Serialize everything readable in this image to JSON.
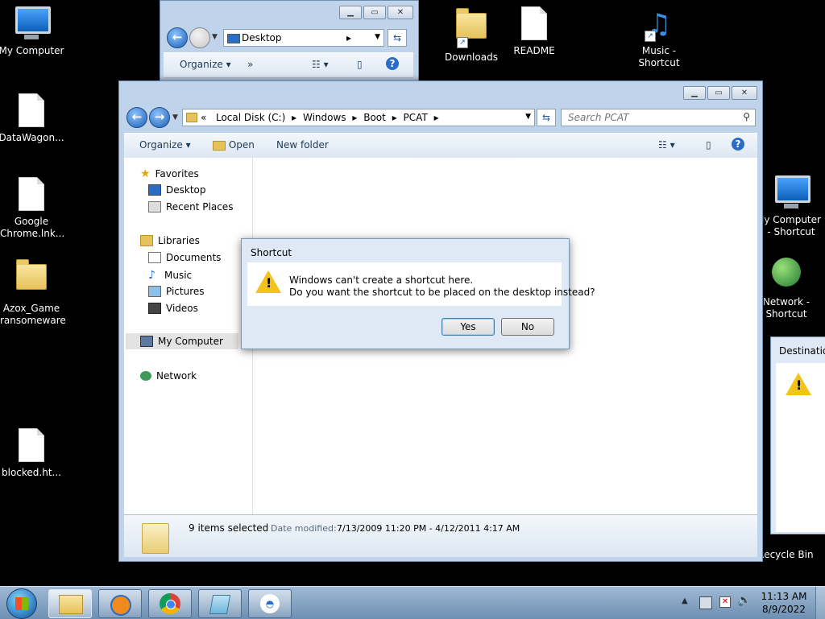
{
  "desktop": {
    "icons_left": [
      {
        "label": "My Computer",
        "kind": "computer"
      },
      {
        "label": "DataWagon...",
        "kind": "file"
      },
      {
        "label": "Google Chrome.lnk...",
        "kind": "file"
      },
      {
        "label": "Azox_Game ransomeware",
        "kind": "folder"
      },
      {
        "label": "blocked.ht...",
        "kind": "file"
      }
    ],
    "icons_top": [
      {
        "label": "Downloads",
        "kind": "folder-shortcut"
      },
      {
        "label": "README",
        "kind": "file"
      },
      {
        "label": "Music - Shortcut",
        "kind": "music-shortcut"
      }
    ],
    "icons_right": [
      {
        "label": "ly Computer - Shortcut"
      },
      {
        "label": "Network - Shortcut"
      },
      {
        "label": "Recycle Bin"
      }
    ]
  },
  "back_window": {
    "address": "Desktop",
    "toolbar": {
      "organize": "Organize",
      "more": "»"
    }
  },
  "explorer": {
    "breadcrumb": [
      "«",
      "Local Disk (C:)",
      "Windows",
      "Boot",
      "PCAT"
    ],
    "search_placeholder": "Search PCAT",
    "toolbar": {
      "organize": "Organize",
      "open": "Open",
      "new_folder": "New folder"
    },
    "nav": {
      "favorites": "Favorites",
      "desktop": "Desktop",
      "recent": "Recent Places",
      "libraries": "Libraries",
      "documents": "Documents",
      "music": "Music",
      "pictures": "Pictures",
      "videos": "Videos",
      "my_computer": "My Computer",
      "network": "Network"
    },
    "details": {
      "count": "9 items selected",
      "date_label": "Date modified:",
      "date_value": "7/13/2009 11:20 PM - 4/12/2011 4:17 AM"
    }
  },
  "dialog": {
    "title": "Shortcut",
    "line1": "Windows can't create a shortcut here.",
    "line2": "Do you want the shortcut to be placed on the desktop instead?",
    "yes": "Yes",
    "no": "No"
  },
  "dest_window": {
    "title": "Destination"
  },
  "taskbar": {
    "time": "11:13 AM",
    "date": "8/9/2022"
  },
  "colors": {
    "accent": "#1b5fb5",
    "warning": "#f3c31a"
  }
}
